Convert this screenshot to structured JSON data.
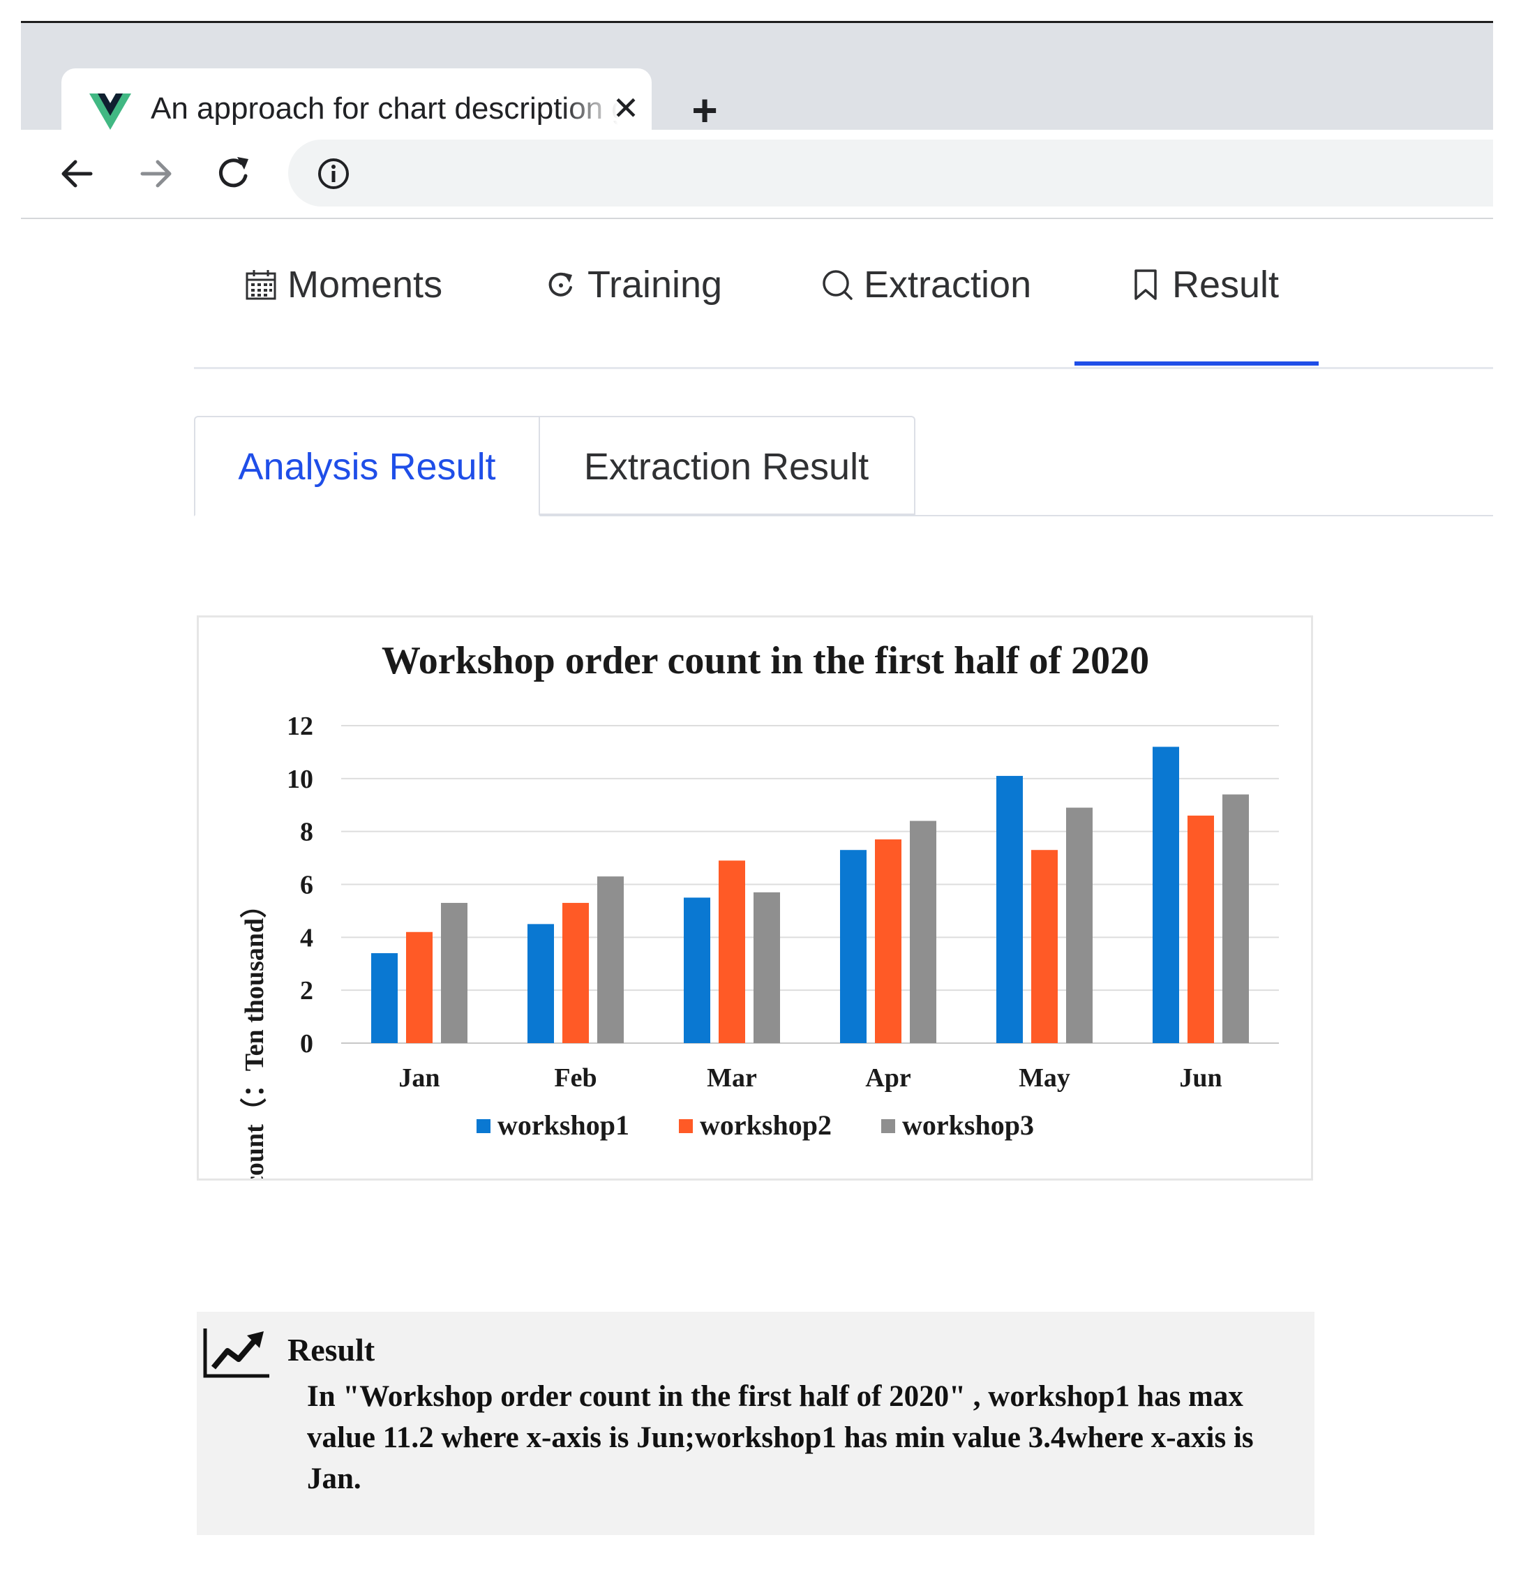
{
  "browser": {
    "tab_title": "An approach for chart description generation in cyber–physical–social system",
    "tab_close": "✕",
    "new_tab": "+"
  },
  "nav": {
    "items": [
      {
        "label": "Moments",
        "icon": "calendar-icon"
      },
      {
        "label": "Training",
        "icon": "refresh-icon"
      },
      {
        "label": "Extraction",
        "icon": "search-icon"
      },
      {
        "label": "Result",
        "icon": "bookmark-icon"
      }
    ],
    "active_index": 3
  },
  "subtabs": {
    "analysis": "Analysis Result",
    "extraction": "Extraction Result",
    "active": "analysis"
  },
  "colors": {
    "accent": "#1f4ee8",
    "workshop1": "#0a78d2",
    "workshop2": "#ff5a26",
    "workshop3": "#8f8f8f"
  },
  "chart_data": {
    "type": "bar",
    "title": "Workshop order count in the first half of 2020",
    "ylabel": "Order count（：Ten thousand）",
    "xlabel": "",
    "categories": [
      "Jan",
      "Feb",
      "Mar",
      "Apr",
      "May",
      "Jun"
    ],
    "ylim": [
      0,
      12
    ],
    "yticks": [
      0,
      2,
      4,
      6,
      8,
      10,
      12
    ],
    "grid": true,
    "legend_position": "bottom",
    "series": [
      {
        "name": "workshop1",
        "values": [
          3.4,
          4.5,
          5.5,
          7.3,
          10.1,
          11.2
        ]
      },
      {
        "name": "workshop2",
        "values": [
          4.2,
          5.3,
          6.9,
          7.7,
          7.3,
          8.6
        ]
      },
      {
        "name": "workshop3",
        "values": [
          5.3,
          6.3,
          5.7,
          8.4,
          8.9,
          9.4
        ]
      }
    ]
  },
  "result": {
    "title": "Result",
    "text": "In \"Workshop order count in the first half of 2020\" , workshop1 has max value 11.2 where x-axis is Jun;workshop1 has min value 3.4where x-axis is Jan."
  }
}
